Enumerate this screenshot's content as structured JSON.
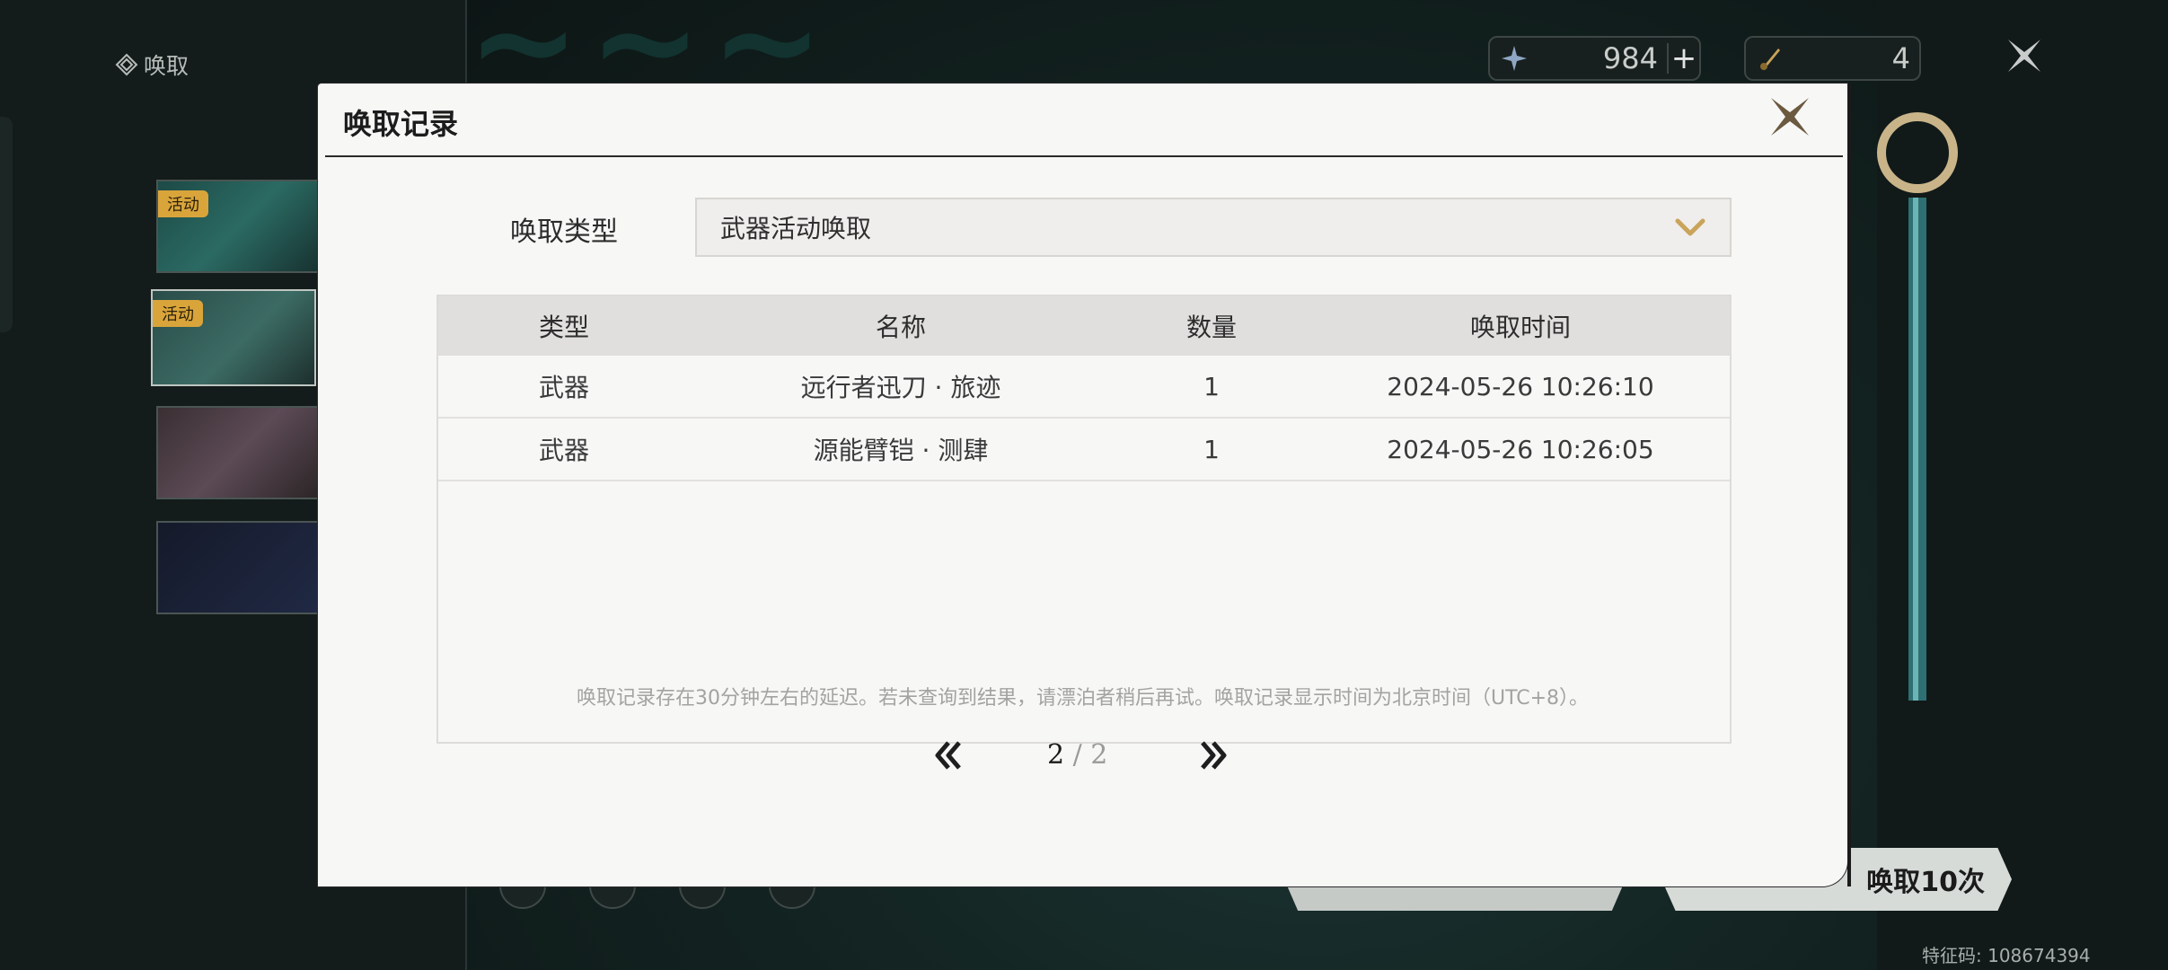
{
  "background": {
    "top_title": "唤取",
    "event_tag": "活动",
    "currency": [
      {
        "icon": "astrite-icon",
        "value": "984"
      },
      {
        "icon": "forging-tide-icon",
        "value": "4"
      }
    ],
    "summon_10_label": "唤取10次",
    "feature_code": "特征码: 108674394"
  },
  "modal": {
    "title": "唤取记录",
    "filter_label": "唤取类型",
    "filter_value": "武器活动唤取",
    "table": {
      "headers": [
        "类型",
        "名称",
        "数量",
        "唤取时间"
      ],
      "rows": [
        [
          "武器",
          "远行者迅刀 · 旅迹",
          "1",
          "2024-05-26 10:26:10"
        ],
        [
          "武器",
          "源能臂铠 · 测肆",
          "1",
          "2024-05-26 10:26:05"
        ]
      ]
    },
    "notice": "唤取记录存在30分钟左右的延迟。若未查询到结果，请漂泊者稍后再试。唤取记录显示时间为北京时间（UTC+8）。",
    "pagination": {
      "current": "2",
      "separator": "/",
      "total": "2"
    }
  },
  "colors": {
    "accent_gold": "#c9a45a",
    "modal_bg": "#f7f7f6",
    "header_row": "#e0dfdd"
  }
}
